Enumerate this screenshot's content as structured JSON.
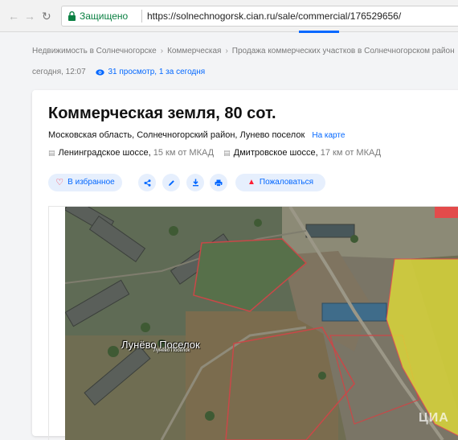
{
  "browser": {
    "back_icon": "arrow-left",
    "forward_icon": "arrow-right",
    "reload_icon": "reload",
    "secure_label": "Защищено",
    "url": "https://solnechnogorsk.cian.ru/sale/commercial/176529656/"
  },
  "breadcrumbs": [
    "Недвижимость в Солнечногорске",
    "Коммерческая",
    "Продажа коммерческих участков в Солнечногорском район"
  ],
  "meta": {
    "date": "сегодня, 12:07",
    "views": "31 просмотр, 1 за сегодня"
  },
  "listing": {
    "title": "Коммерческая земля, 80 сот.",
    "address": "Московская область, Солнечногорский район, Лунево поселок",
    "map_link": "На карте",
    "highways": [
      {
        "name": "Ленинградское шоссе,",
        "distance": "15 км от МКАД"
      },
      {
        "name": "Дмитровское шоссе,",
        "distance": "17 км от МКАД"
      }
    ]
  },
  "actions": {
    "favorite_label": "В избранное",
    "report_label": "Пожаловаться"
  },
  "map": {
    "place_label": "Лунёво Поселок",
    "place_sublabel": "Лунёво Поселок",
    "watermark": "ЦИА"
  },
  "colors": {
    "accent": "#0468ff",
    "button_bg": "#e6effd",
    "heart": "#ff1f34",
    "secure": "#0b8043",
    "highlight_area": "#e8e83a"
  }
}
